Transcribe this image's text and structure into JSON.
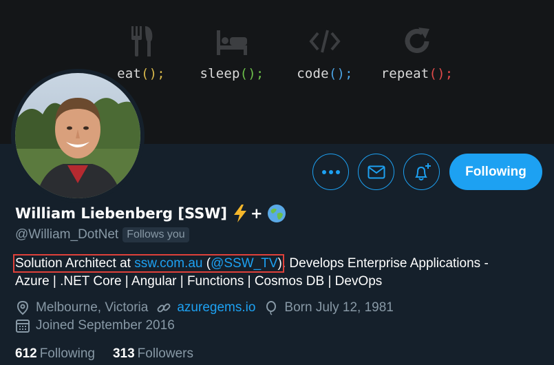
{
  "banner": {
    "items": [
      {
        "word": "eat",
        "parens": "();",
        "icon": "utensils-icon",
        "paren_color": "#d6b64a"
      },
      {
        "word": "sleep",
        "parens": "();",
        "icon": "bed-icon",
        "paren_color": "#6cc04a"
      },
      {
        "word": "code",
        "parens": "();",
        "icon": "code-icon",
        "paren_color": "#4ba3e3"
      },
      {
        "word": "repeat",
        "parens": "();",
        "icon": "repeat-icon",
        "paren_color": "#e14a4a"
      }
    ]
  },
  "profile": {
    "display_name": "William Liebenberg [SSW]",
    "name_suffix_plus": "+",
    "handle": "@William_DotNet",
    "follows_you_badge": "Follows you",
    "bio": {
      "highlight_prefix": "Solution Architect at ",
      "link1": "ssw.com.au",
      "mid_open": " (",
      "link2": "@SSW_TV",
      "highlight_close": ")",
      "rest_line1": ". Develops Enterprise Applications -",
      "line2": "Azure | .NET Core | Angular |  Functions | Cosmos DB | DevOps"
    },
    "location": "Melbourne, Victoria",
    "website": "azuregems.io",
    "birthday": "Born July 12, 1981",
    "joined": "Joined September 2016"
  },
  "actions": {
    "more_icon": "more-icon",
    "message_icon": "envelope-icon",
    "notify_icon": "bell-plus-icon",
    "following_label": "Following"
  },
  "stats": {
    "following_count": "612",
    "following_label": "Following",
    "followers_count": "313",
    "followers_label": "Followers"
  },
  "colors": {
    "background": "#15202b",
    "banner": "#141618",
    "accent": "#1da1f2",
    "secondary_text": "#8899a6",
    "highlight_box": "#e0413a"
  }
}
